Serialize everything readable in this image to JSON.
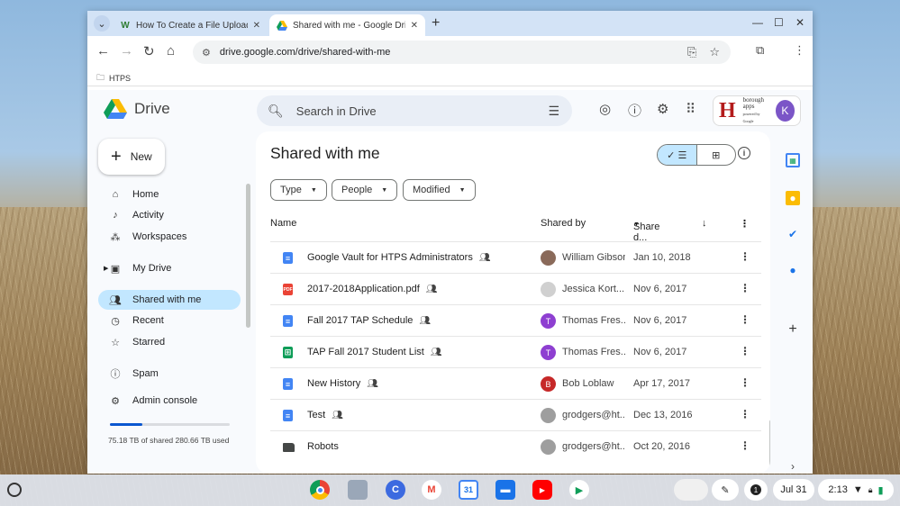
{
  "browser": {
    "tabs": [
      {
        "favicon": "W",
        "title": "How To Create a File Upload B",
        "active": false
      },
      {
        "favicon": "drive-icon",
        "title": "Shared with me - Google Drive",
        "active": true
      }
    ],
    "url": "drive.google.com/drive/shared-with-me",
    "bookmarks": [
      {
        "label": "HTPS"
      }
    ]
  },
  "drive": {
    "app_name": "Drive",
    "search_placeholder": "Search in Drive",
    "new_label": "New",
    "account": {
      "org_letter": "H",
      "org_name_line1": "borough",
      "org_name_line2": "apps",
      "org_tagline": "powered by Google",
      "avatar_letter": "K"
    },
    "nav": [
      {
        "label": "Home",
        "icon": "home-icon"
      },
      {
        "label": "Activity",
        "icon": "bell-icon"
      },
      {
        "label": "Workspaces",
        "icon": "workspaces-icon"
      },
      {
        "label": "My Drive",
        "icon": "my-drive-icon"
      },
      {
        "label": "Shared with me",
        "icon": "people-icon",
        "active": true
      },
      {
        "label": "Recent",
        "icon": "clock-icon"
      },
      {
        "label": "Starred",
        "icon": "star-icon"
      },
      {
        "label": "Spam",
        "icon": "spam-icon"
      },
      {
        "label": "Admin console",
        "icon": "admin-icon"
      }
    ],
    "storage": {
      "text": "75.18 TB of shared 280.66 TB used",
      "fraction": 0.27
    },
    "page_title": "Shared with me",
    "filters": [
      {
        "label": "Type"
      },
      {
        "label": "People"
      },
      {
        "label": "Modified"
      }
    ],
    "columns": {
      "name": "Name",
      "shared_by": "Shared by",
      "share_date": "Share d..."
    },
    "files": [
      {
        "name": "Google Vault for HTPS Administrators",
        "type": "doc",
        "owner": "William Gibson",
        "avatar": "",
        "avatar_color": "#8a6a5a",
        "date": "Jan 10, 2018"
      },
      {
        "name": "2017-2018Application.pdf",
        "type": "pdf",
        "owner": "Jessica Kort...",
        "avatar": "",
        "avatar_color": "#d0d0d0",
        "date": "Nov 6, 2017"
      },
      {
        "name": "Fall 2017 TAP Schedule",
        "type": "doc",
        "owner": "Thomas Fres...",
        "avatar": "T",
        "avatar_color": "#8e3fd1",
        "date": "Nov 6, 2017"
      },
      {
        "name": "TAP Fall 2017 Student List",
        "type": "sheet",
        "owner": "Thomas Fres...",
        "avatar": "T",
        "avatar_color": "#8e3fd1",
        "date": "Nov 6, 2017"
      },
      {
        "name": "New History",
        "type": "doc",
        "owner": "Bob Loblaw",
        "avatar": "B",
        "avatar_color": "#c62828",
        "date": "Apr 17, 2017"
      },
      {
        "name": "Test",
        "type": "doc",
        "owner": "grodgers@ht...",
        "avatar": "",
        "avatar_color": "#9e9e9e",
        "date": "Dec 13, 2016"
      },
      {
        "name": "Robots",
        "type": "folder",
        "owner": "grodgers@ht...",
        "avatar": "",
        "avatar_color": "#9e9e9e",
        "date": "Oct 20, 2016"
      }
    ]
  },
  "shelf": {
    "apps": [
      "chrome-icon",
      "files-app-icon",
      "canvas-icon",
      "gmail-icon",
      "calendar-icon",
      "files-icon",
      "youtube-icon",
      "play-store-icon"
    ],
    "calendar_day": "31",
    "date": "Jul 31",
    "time": "2:13"
  },
  "colors": {
    "accent": "#0b57d0",
    "active_nav": "#c2e7ff",
    "doc": "#4285f4",
    "pdf": "#ea4335",
    "sheet": "#0f9d58",
    "folder": "#444746"
  }
}
